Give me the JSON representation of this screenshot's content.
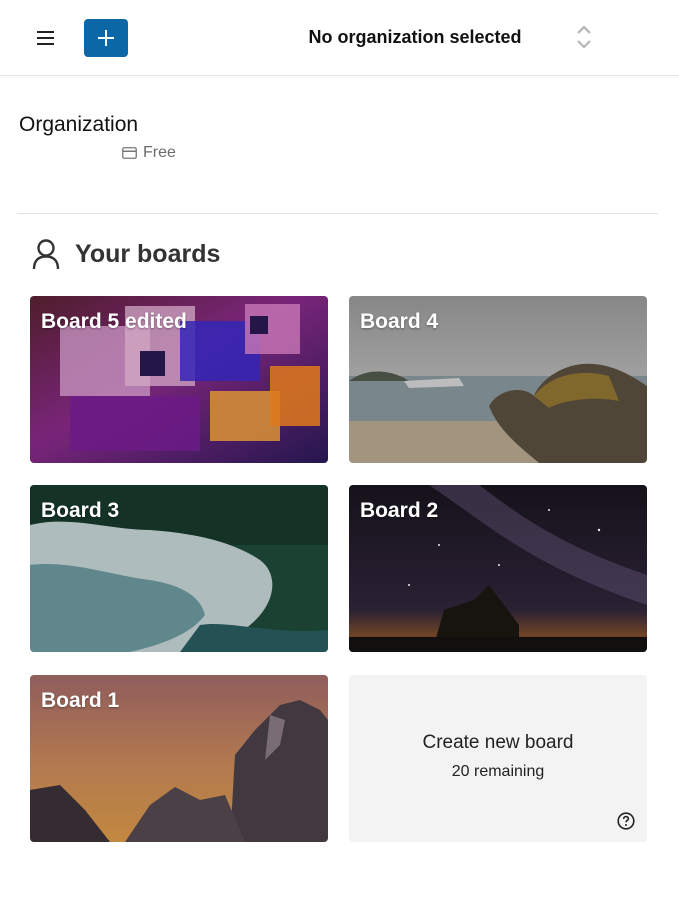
{
  "header": {
    "menu_icon": "hamburger-menu-icon",
    "add_icon": "plus-icon",
    "org_selector_label": "No organization selected",
    "org_selector_icon": "up-down-chevrons-icon",
    "accent_color": "#0b67a5"
  },
  "organization": {
    "title": "Organization",
    "plan_icon": "credit-card-icon",
    "plan": "Free"
  },
  "boards_section": {
    "icon": "user-icon",
    "title": "Your boards",
    "boards": [
      {
        "title": "Board 5 edited"
      },
      {
        "title": "Board 4"
      },
      {
        "title": "Board 3"
      },
      {
        "title": "Board 2"
      },
      {
        "title": "Board 1"
      }
    ],
    "create": {
      "title": "Create new board",
      "remaining": "20 remaining",
      "help_icon": "help-circle-icon"
    }
  }
}
